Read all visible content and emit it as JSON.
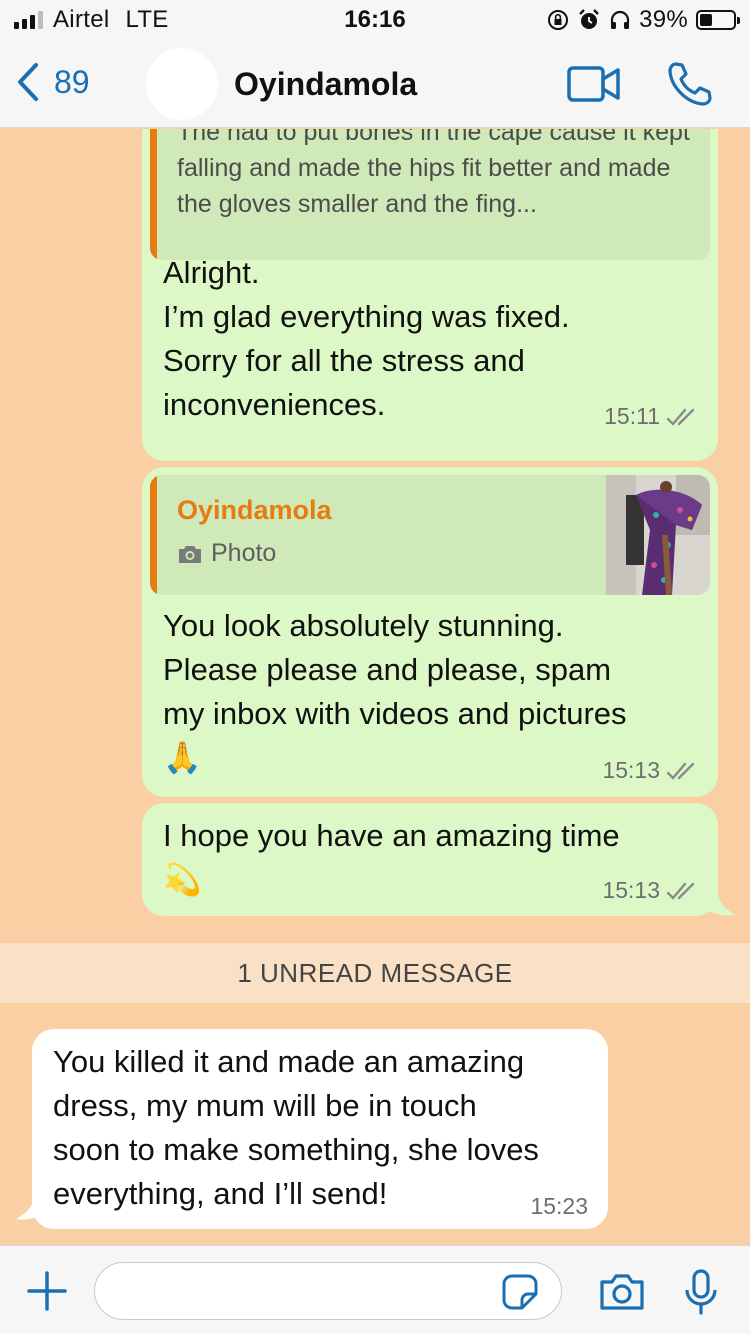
{
  "status_bar": {
    "carrier": "Airtel",
    "network": "LTE",
    "time": "16:16",
    "battery": "39%",
    "battery_level": 0.39
  },
  "header": {
    "back_count": "89",
    "contact_name": "Oyindamola"
  },
  "messages": [
    {
      "quote_text": "The had to put bones in the cape cause it kept falling and made the hips fit better and made the gloves smaller and the fing...",
      "lines": [
        "Alright.",
        "I’m glad everything was fixed.",
        "Sorry for all the stress and",
        "inconveniences."
      ],
      "time": "15:11"
    },
    {
      "quote_name": "Oyindamola",
      "quote_photo_label": "Photo",
      "lines": [
        "You look absolutely stunning.",
        "Please please and please, spam",
        "my inbox with videos and pictures",
        "🙏"
      ],
      "time": "15:13"
    },
    {
      "lines": [
        "I hope you have an amazing time",
        "💫"
      ],
      "time": "15:13"
    }
  ],
  "unread_label": "1 UNREAD MESSAGE",
  "incoming": {
    "lines": [
      "You killed it and made an amazing",
      "dress, my mum will be in touch",
      "soon to make something, she loves",
      "everything, and I’ll send!"
    ],
    "time": "15:23"
  },
  "colors": {
    "background": "#f9cfa3",
    "outgoing_bubble": "#dcf8c6",
    "accent": "#1a6fb3",
    "quote_name": "#e67b12"
  }
}
